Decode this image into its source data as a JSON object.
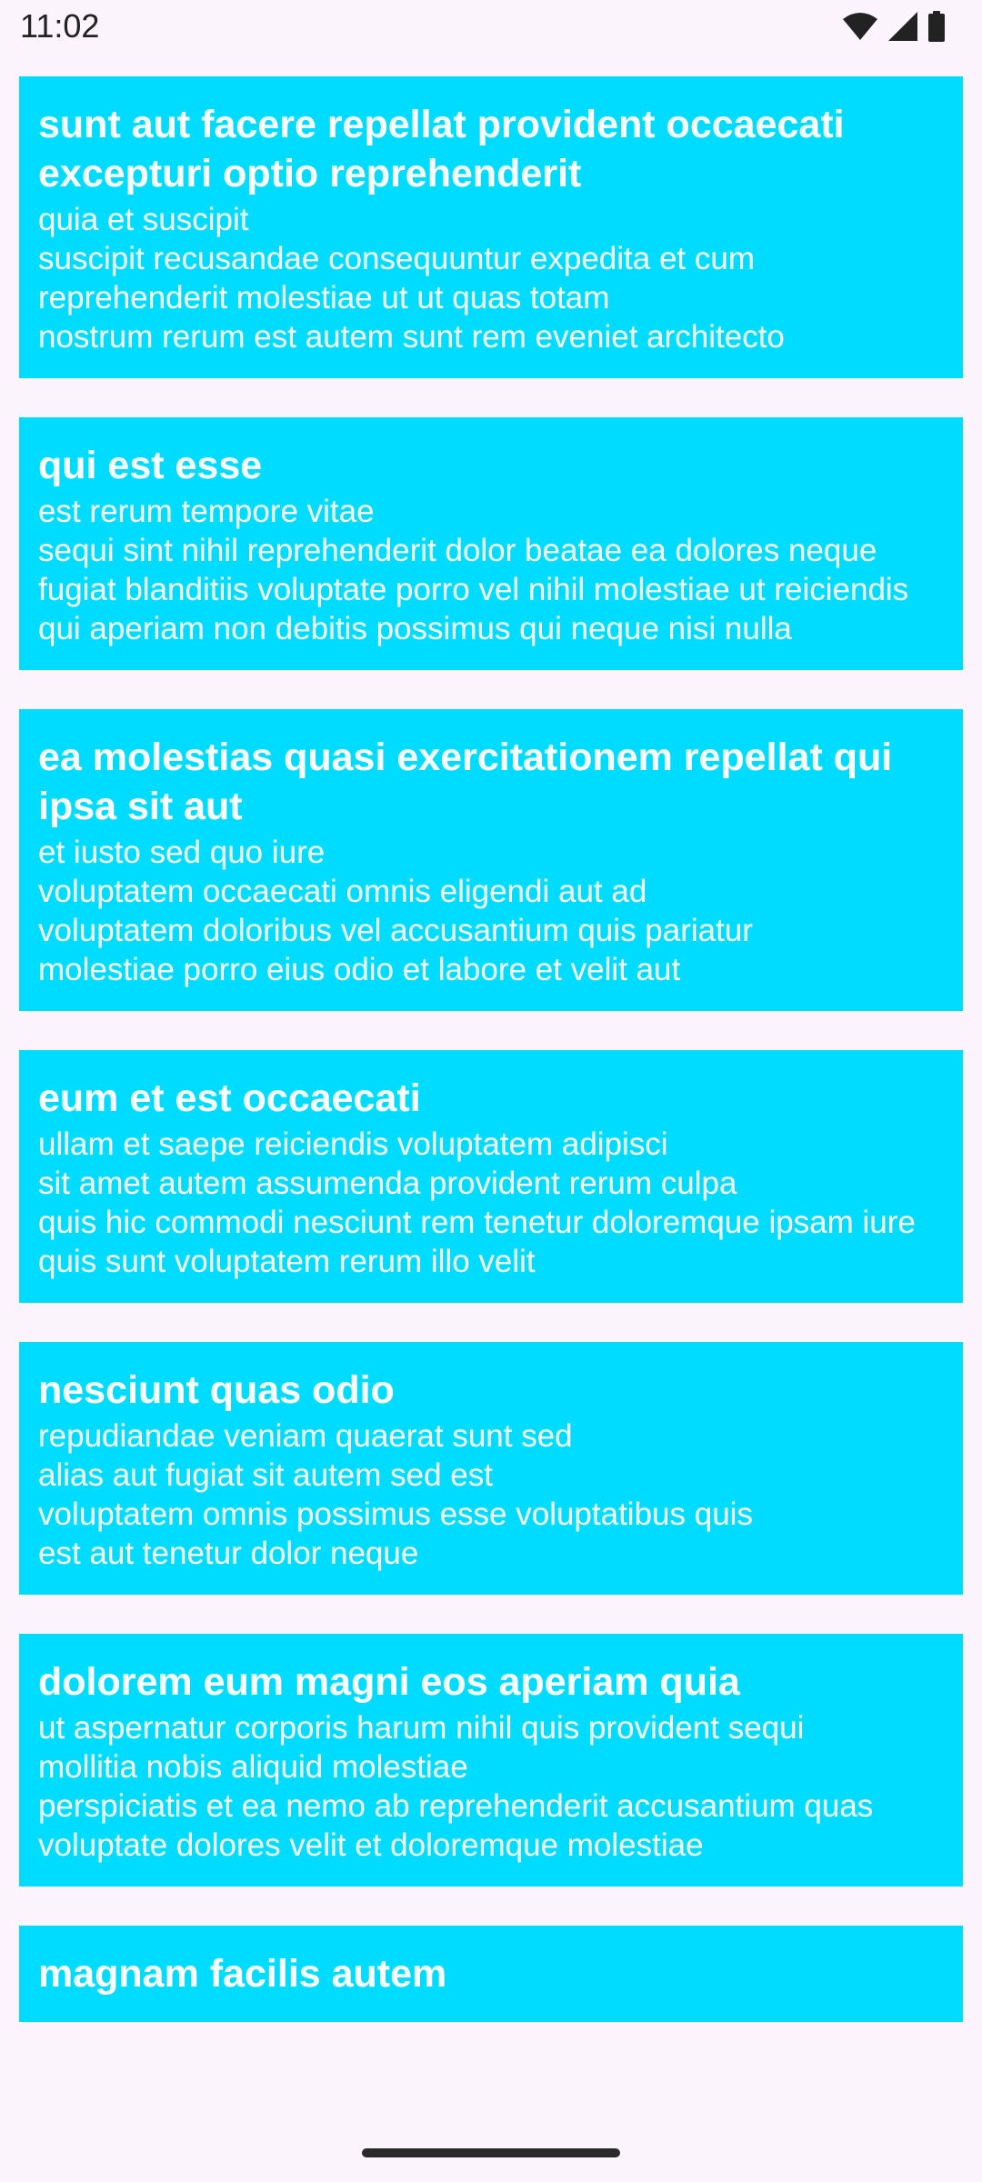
{
  "status_bar": {
    "time": "11:02",
    "icons": [
      "wifi-icon",
      "signal-icon",
      "battery-icon"
    ]
  },
  "colors": {
    "card_background": "#00dcff",
    "card_text": "#ffffff",
    "page_background": "#fcf4fc"
  },
  "posts": [
    {
      "title": "sunt aut facere repellat provident occaecati excepturi optio reprehenderit",
      "body": "quia et suscipit\nsuscipit recusandae consequuntur expedita et cum\nreprehenderit molestiae ut ut quas totam\nnostrum rerum est autem sunt rem eveniet architecto"
    },
    {
      "title": "qui est esse",
      "body": "est rerum tempore vitae\nsequi sint nihil reprehenderit dolor beatae ea dolores neque\nfugiat blanditiis voluptate porro vel nihil molestiae ut reiciendis\nqui aperiam non debitis possimus qui neque nisi nulla"
    },
    {
      "title": "ea molestias quasi exercitationem repellat qui ipsa sit aut",
      "body": "et iusto sed quo iure\nvoluptatem occaecati omnis eligendi aut ad\nvoluptatem doloribus vel accusantium quis pariatur\nmolestiae porro eius odio et labore et velit aut"
    },
    {
      "title": "eum et est occaecati",
      "body": "ullam et saepe reiciendis voluptatem adipisci\nsit amet autem assumenda provident rerum culpa\nquis hic commodi nesciunt rem tenetur doloremque ipsam iure\nquis sunt voluptatem rerum illo velit"
    },
    {
      "title": "nesciunt quas odio",
      "body": "repudiandae veniam quaerat sunt sed\nalias aut fugiat sit autem sed est\nvoluptatem omnis possimus esse voluptatibus quis\nest aut tenetur dolor neque"
    },
    {
      "title": "dolorem eum magni eos aperiam quia",
      "body": "ut aspernatur corporis harum nihil quis provident sequi\nmollitia nobis aliquid molestiae\nperspiciatis et ea nemo ab reprehenderit accusantium quas\nvoluptate dolores velit et doloremque molestiae"
    },
    {
      "title": "magnam facilis autem",
      "body": ""
    }
  ]
}
